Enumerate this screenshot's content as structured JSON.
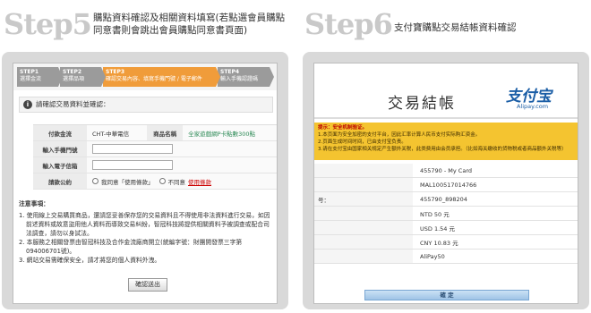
{
  "steps": [
    {
      "title": "Step5",
      "desc": "購點資料確認及相關資料填寫(若點選會員購點同意書則會跳出會員購點同意書頁面)"
    },
    {
      "title": "Step6",
      "desc": "支付寶購點交易結帳資料確認"
    }
  ],
  "left": {
    "progress": [
      {
        "num": "STEP1",
        "label": "選擇金流"
      },
      {
        "num": "STEP2",
        "label": "選擇品項"
      },
      {
        "num": "STEP3",
        "label": "確認交易內容、填寫手機門號 / 電子郵件"
      },
      {
        "num": "STEP4",
        "label": "輸入手機認證碼"
      }
    ],
    "prompt": "請確認交易資料並確認：",
    "form": {
      "pay_label": "付款金流",
      "pay_value": "CHT-中華電信",
      "product_label": "商品名稱",
      "product_value": "全家遊戲網P卡點數300點",
      "phone_label": "輸入手機門號",
      "email_label": "輸入電子信箱",
      "agree_label": "請款公約",
      "agree_yes": "我同意「使用條款」",
      "agree_no": "不同意",
      "agree_link": "使用條款"
    },
    "notes_title": "注意事項：",
    "notes": [
      "1. 使用線上交易購買商品，還請您妥善保存您的交易資料且不得使用非法資料進行交易，如因前述資料或故意盜用他人資料而導致交易糾紛，智冠科技將提供相關資料予被調查或配合司法調查，請勿以身試法。",
      "2. 本服務之相關發票由智冠科技及合作金流廠商開立(統編字號：財團開發票三字第094006701號)。",
      "3. 網站交易需確保安全，請才將您的個人資料外洩。"
    ],
    "confirm": "確認送出"
  },
  "right": {
    "title": "交易結帳",
    "logo": "支付宝",
    "logo_url": "Alipay.com",
    "notice_lines": [
      "提示：安全机制验证。",
      "1.本页面为安全加密的支付平台，因此汇率计算人民币支付实际购汇资金。",
      "2.页面生成时间时间，已由支付宝负责。",
      "3.请在支付宝由国家相关规定产生额外关税，此类费用由会员承担。（比如海关缴收的货物税或者商品额外关税等）"
    ],
    "rows": [
      {
        "label": "",
        "value": "455790 - My Card"
      },
      {
        "label": "",
        "value": "MAL100517014766"
      },
      {
        "label": "号：",
        "value": "455790_898204"
      },
      {
        "label": "",
        "value": "NTD 50 元"
      },
      {
        "label": "",
        "value": "USD 1.54 元"
      },
      {
        "label": "",
        "value": "CNY 10.83 元"
      },
      {
        "label": "",
        "value": "AliPay50"
      }
    ],
    "confirm": "確    定"
  }
}
